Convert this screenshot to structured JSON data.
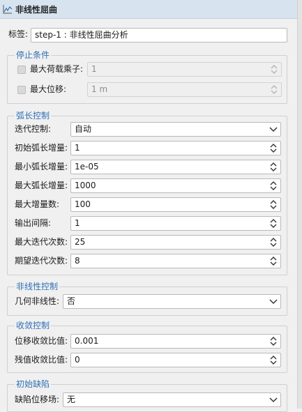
{
  "header": {
    "title": "非线性屈曲"
  },
  "label": {
    "caption": "标签:",
    "value": "step-1 : 非线性屈曲分析"
  },
  "stop": {
    "title": "停止条件",
    "max_load_factor": {
      "label": "最大荷载乘子:",
      "value": "1"
    },
    "max_displacement": {
      "label": "最大位移:",
      "value": "1 m"
    }
  },
  "arc": {
    "title": "弧长控制",
    "iter_control": {
      "label": "迭代控制:",
      "value": "自动"
    },
    "init_inc": {
      "label": "初始弧长增量:",
      "value": "1"
    },
    "min_inc": {
      "label": "最小弧长增量:",
      "value": "1e-05"
    },
    "max_inc": {
      "label": "最大弧长增量:",
      "value": "1000"
    },
    "max_incs": {
      "label": "最大增量数:",
      "value": "100"
    },
    "output_interval": {
      "label": "输出间隔:",
      "value": "1"
    },
    "max_iters": {
      "label": "最大迭代次数:",
      "value": "25"
    },
    "expected_iters": {
      "label": "期望迭代次数:",
      "value": "8"
    }
  },
  "nonlinear": {
    "title": "非线性控制",
    "geometric": {
      "label": "几何非线性:",
      "value": "否"
    }
  },
  "convergence": {
    "title": "收敛控制",
    "disp_ratio": {
      "label": "位移收敛比值:",
      "value": "0.001"
    },
    "resid_ratio": {
      "label": "残值收敛比值:",
      "value": "0"
    }
  },
  "imperfection": {
    "title": "初始缺陷",
    "defect_field": {
      "label": "缺陷位移场:",
      "value": "无"
    }
  },
  "colors": {
    "accent": "#2e6fb5",
    "header_bg": "#d7e3ef"
  }
}
